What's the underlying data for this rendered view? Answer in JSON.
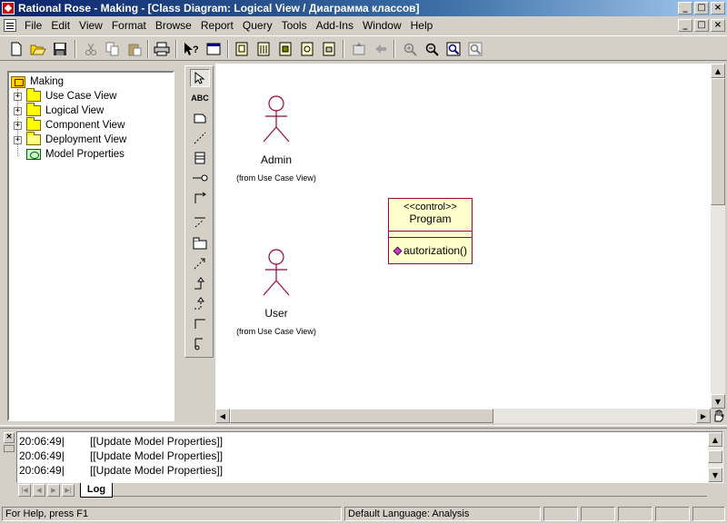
{
  "window": {
    "title": "Rational Rose - Making - [Class Diagram: Logical View / Диаграмма классов]",
    "caption_buttons": [
      "_",
      "□",
      "×"
    ]
  },
  "menu": {
    "items": [
      "File",
      "Edit",
      "View",
      "Format",
      "Browse",
      "Report",
      "Query",
      "Tools",
      "Add-Ins",
      "Window",
      "Help"
    ]
  },
  "toolbar": {
    "icons": [
      "new-icon",
      "open-icon",
      "save-icon",
      "cut-icon",
      "copy-icon",
      "paste-icon",
      "print-icon",
      "context-help-icon",
      "view-doc-icon",
      "browse-class-diagram-icon",
      "browse-interaction-diagram-icon",
      "browse-component-diagram-icon",
      "browse-deployment-diagram-icon",
      "browse-parent-icon",
      "browse-previous-icon",
      "zoom-in-icon",
      "zoom-out-icon",
      "fit-in-window-icon",
      "undo-fit-icon"
    ]
  },
  "browser": {
    "root": "Making",
    "items": [
      {
        "label": "Use Case View",
        "icon": "folder-icon",
        "expandable": true
      },
      {
        "label": "Logical View",
        "icon": "folder-icon",
        "expandable": true
      },
      {
        "label": "Component View",
        "icon": "folder-icon",
        "expandable": true
      },
      {
        "label": "Deployment View",
        "icon": "deployment-icon",
        "expandable": true
      },
      {
        "label": "Model Properties",
        "icon": "model-properties-icon",
        "expandable": false
      }
    ]
  },
  "toolbox": {
    "tools": [
      "selection-icon",
      "text-icon",
      "note-icon",
      "anchor-note-icon",
      "class-icon",
      "interface-icon",
      "unidirectional-association-icon",
      "association-class-icon",
      "package-icon",
      "dependency-icon",
      "generalization-icon",
      "realize-icon",
      "aggregation-icon",
      "unidirectional-aggregation-icon"
    ],
    "text_tool_label": "ABC"
  },
  "diagram": {
    "actors": [
      {
        "name": "Admin",
        "source": "(from Use Case View)"
      },
      {
        "name": "User",
        "source": "(from Use Case View)"
      }
    ],
    "class": {
      "stereotype": "<<control>>",
      "name": "Program",
      "operation": "autorization()"
    },
    "colors": {
      "actor_stroke": "#a00040",
      "class_fill": "#ffffcc",
      "class_border": "#a00040"
    }
  },
  "log": {
    "lines": [
      {
        "time": "20:06:49|",
        "message": "[[Update Model Properties]]"
      },
      {
        "time": "20:06:49|",
        "message": "[[Update Model Properties]]"
      },
      {
        "time": "20:06:49|",
        "message": "[[Update Model Properties]]"
      }
    ],
    "tab": "Log"
  },
  "status": {
    "help": "For Help, press F1",
    "language": "Default Language: Analysis"
  }
}
